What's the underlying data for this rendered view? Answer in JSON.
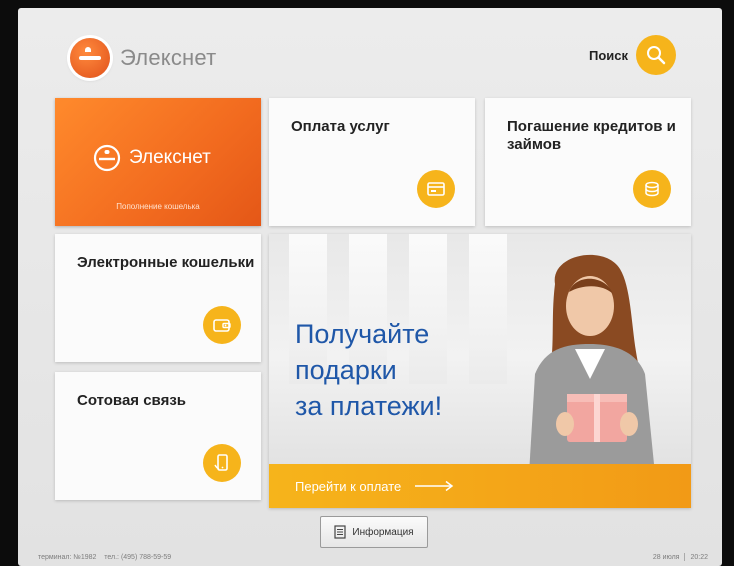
{
  "header": {
    "brand": "Элекснет",
    "search_label": "Поиск"
  },
  "tiles": {
    "wallet": {
      "brand": "Элекснет",
      "caption": "Пополнение кошелька"
    },
    "payments": {
      "title": "Оплата услуг",
      "icon": "card-terminal-icon"
    },
    "loans": {
      "title": "Погашение кредитов и займов",
      "icon": "coins-icon"
    },
    "ewallets": {
      "title": "Электронные кошельки",
      "icon": "wallet-icon"
    },
    "mobile": {
      "title": "Сотовая связь",
      "icon": "phone-icon"
    }
  },
  "banner": {
    "line1": "Получайте",
    "line2": "подарки",
    "line3": "за платежи!",
    "cta": "Перейти к оплате"
  },
  "info_button": {
    "label": "Информация"
  },
  "footer": {
    "terminal": "терминал: №1982",
    "phone": "тел.: (495) 788-59-59",
    "date": "28 июля",
    "time": "20:22"
  },
  "colors": {
    "accent_orange": "#f26b1f",
    "accent_yellow": "#f6b41b",
    "banner_text_blue": "#1f57a8"
  }
}
